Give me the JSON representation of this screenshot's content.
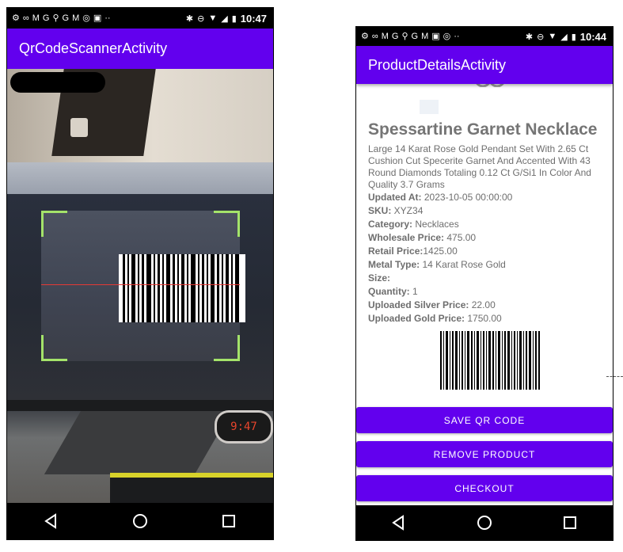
{
  "left_phone": {
    "status": {
      "left_icons": [
        "⚙",
        "∞",
        "M",
        "G",
        "⚲",
        "G",
        "M",
        "◎",
        "▣",
        "··"
      ],
      "right_icons": [
        "✱",
        "⊖",
        "▼",
        "◢",
        "▮"
      ],
      "time": "10:47"
    },
    "appbar_title": "QrCodeScannerActivity",
    "camera": {
      "clock_display": "9:47"
    },
    "nav": {
      "back_icon": "◁",
      "home_icon": "○",
      "recents_icon": "□"
    }
  },
  "right_phone": {
    "status": {
      "left_icons": [
        "⚙",
        "∞",
        "M",
        "G",
        "⚲",
        "G",
        "M",
        "▣",
        "◎",
        "··"
      ],
      "right_icons": [
        "✱",
        "⊖",
        "▼",
        "◢",
        "▮"
      ],
      "time": "10:44"
    },
    "appbar_title": "ProductDetailsActivity",
    "product": {
      "name": "Spessartine Garnet Necklace",
      "description": "Large 14 Karat Rose Gold Pendant Set With 2.65 Ct Cushion Cut Specerite Garnet And Accented With 43 Round Diamonds Totaling 0.12 Ct G/Si1 In Color And Quality 3.7 Grams",
      "fields": [
        {
          "label": "Updated At:",
          "value": " 2023-10-05 00:00:00"
        },
        {
          "label": "SKU:",
          "value": " XYZ34"
        },
        {
          "label": "Category:",
          "value": " Necklaces"
        },
        {
          "label": "Wholesale Price:",
          "value": " 475.00"
        },
        {
          "label": "Retail Price:",
          "value": "1425.00"
        },
        {
          "label": "Metal Type:",
          "value": " 14 Karat Rose Gold"
        },
        {
          "label": "Size:",
          "value": ""
        },
        {
          "label": "Quantity:",
          "value": " 1"
        },
        {
          "label": "Uploaded Silver Price:",
          "value": " 22.00"
        },
        {
          "label": "Uploaded Gold Price:",
          "value": " 1750.00"
        }
      ]
    },
    "buttons": {
      "save": "SAVE QR CODE",
      "remove": "REMOVE PRODUCT",
      "checkout": "CHECKOUT"
    },
    "nav": {
      "back_icon": "◁",
      "home_icon": "○",
      "recents_icon": "□"
    }
  },
  "colors": {
    "primary": "#6200ee",
    "scanner_corner": "#a4e36a",
    "laser": "#e53935"
  }
}
